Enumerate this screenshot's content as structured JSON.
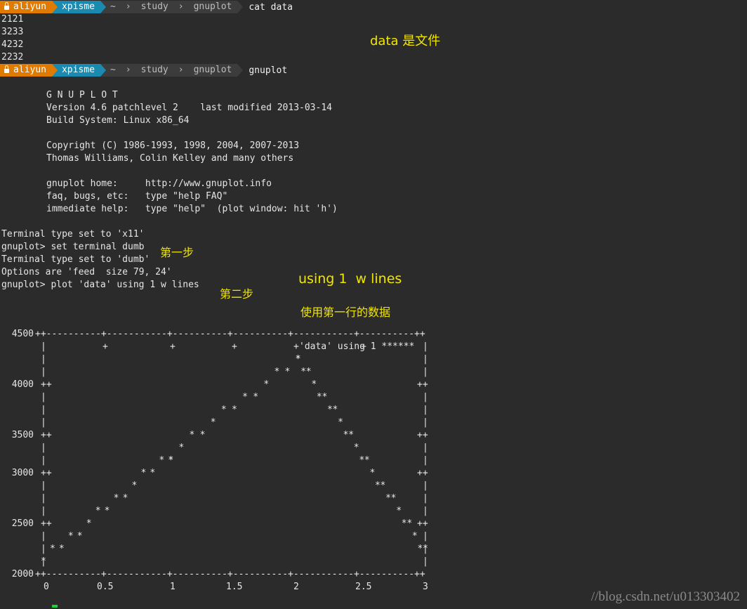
{
  "prompt": {
    "user": "aliyun",
    "host": "xpisme",
    "path": [
      "~",
      "study",
      "gnuplot"
    ],
    "colors": {
      "user": "#e07b00",
      "host": "#1a8ab0",
      "path": "#3c3c3c"
    }
  },
  "cmd1": "cat data",
  "data_lines": [
    "2121",
    "3233",
    "4232",
    "2232"
  ],
  "cmd2": "gnuplot",
  "banner": [
    "G N U P L O T",
    "Version 4.6 patchlevel 2    last modified 2013-03-14",
    "Build System: Linux x86_64",
    "",
    "Copyright (C) 1986-1993, 1998, 2004, 2007-2013",
    "Thomas Williams, Colin Kelley and many others",
    "",
    "gnuplot home:     http://www.gnuplot.info",
    "faq, bugs, etc:   type \"help FAQ\"",
    "immediate help:   type \"help\"  (plot window: hit 'h')"
  ],
  "session": [
    "Terminal type set to 'x11'",
    "gnuplot> set terminal dumb",
    "Terminal type set to 'dumb'",
    "Options are 'feed  size 79, 24'",
    "gnuplot> plot 'data' using 1 w lines"
  ],
  "annotations": {
    "data_file": "data 是文件",
    "step1": "第一步",
    "step2": "第二步",
    "using": "using 1  w lines",
    "first_row": "使用第一行的数据"
  },
  "chart_data": {
    "type": "line",
    "legend": "'data' using 1 ******",
    "x": [
      0,
      1,
      2,
      3
    ],
    "series": [
      {
        "name": "'data' using 1",
        "values": [
          2121,
          3233,
          4232,
          2232
        ]
      }
    ],
    "xlim": [
      0,
      3
    ],
    "ylim": [
      2000,
      4500
    ],
    "xticks": [
      "0",
      "0.5",
      "1",
      "1.5",
      "2",
      "2.5",
      "3"
    ],
    "yticks": [
      "4500",
      "4000",
      "3500",
      "3000",
      "2500",
      "2000"
    ],
    "legend_position": "top-right"
  },
  "watermark": "//blog.csdn.net/u013303402"
}
